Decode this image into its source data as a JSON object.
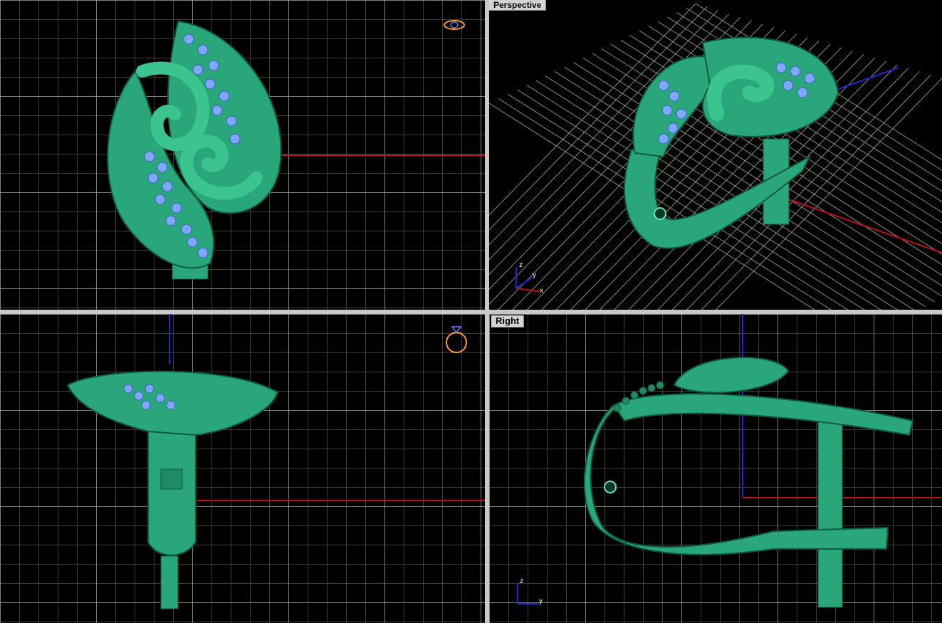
{
  "viewports": {
    "top": {
      "label": ""
    },
    "perspective": {
      "label": "Perspective"
    },
    "front": {
      "label": ""
    },
    "right": {
      "label": "Right"
    }
  },
  "axes": {
    "perspective": {
      "z": "z",
      "y": "y",
      "x": "x"
    },
    "right": {
      "z": "z",
      "y": "y"
    }
  },
  "colors": {
    "background": "#000000",
    "model": "#2aa77a",
    "model_highlight": "#6fe0b2",
    "stones": "#7ea7ff",
    "x_axis": "#c01010",
    "y_axis": "#1a2ad0",
    "separator": "#c8c8c8"
  },
  "icons": {
    "top_widget": "ring-top-view-icon",
    "front_widget": "ring-front-view-icon"
  }
}
